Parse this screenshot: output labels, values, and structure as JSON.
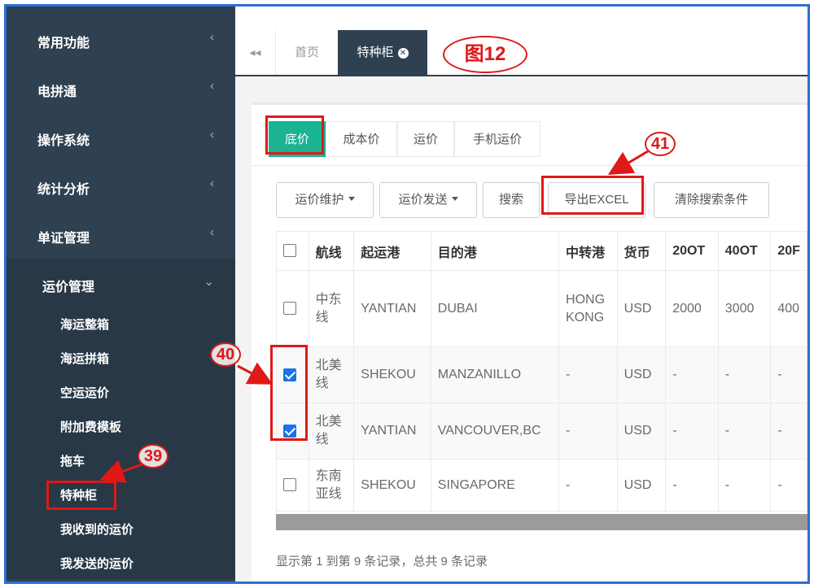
{
  "sidebar": {
    "items": [
      {
        "label": "常用功能",
        "chevron": "‹"
      },
      {
        "label": "电拼通",
        "chevron": "‹"
      },
      {
        "label": "操作系统",
        "chevron": "‹"
      },
      {
        "label": "统计分析",
        "chevron": "‹"
      },
      {
        "label": "单证管理",
        "chevron": "‹"
      },
      {
        "label": "运价管理",
        "chevron": "⌄"
      }
    ],
    "subitems": [
      "海运整箱",
      "海运拼箱",
      "空运运价",
      "附加费模板",
      "拖车",
      "特种柜",
      "我收到的运价",
      "我发送的运价"
    ]
  },
  "tabs": {
    "back_icon": "◂◂",
    "home": "首页",
    "active": "特种柜",
    "close_icon": "✕"
  },
  "figure_label": "图12",
  "subtabs": [
    "底价",
    "成本价",
    "运价",
    "手机运价"
  ],
  "toolbar": {
    "maintain": "运价维护",
    "send": "运价发送",
    "search": "搜索",
    "export": "导出EXCEL",
    "clear": "清除搜索条件"
  },
  "table": {
    "headers": [
      "航线",
      "起运港",
      "目的港",
      "中转港",
      "货币",
      "20OT",
      "40OT",
      "20F"
    ],
    "rows": [
      {
        "checked": false,
        "route": "中东线",
        "origin": "YANTIAN",
        "dest": "DUBAI",
        "transit": "HONG KONG",
        "currency": "USD",
        "c20ot": "2000",
        "c40ot": "3000",
        "c20f": "400"
      },
      {
        "checked": true,
        "route": "北美线",
        "origin": "SHEKOU",
        "dest": "MANZANILLO",
        "transit": "-",
        "currency": "USD",
        "c20ot": "-",
        "c40ot": "-",
        "c20f": "-"
      },
      {
        "checked": true,
        "route": "北美线",
        "origin": "YANTIAN",
        "dest": "VANCOUVER,BC",
        "transit": "-",
        "currency": "USD",
        "c20ot": "-",
        "c40ot": "-",
        "c20f": "-"
      },
      {
        "checked": false,
        "route": "东南亚线",
        "origin": "SHEKOU",
        "dest": "SINGAPORE",
        "transit": "-",
        "currency": "USD",
        "c20ot": "-",
        "c40ot": "-",
        "c20f": "-"
      }
    ]
  },
  "footer": "显示第 1 到第 9 条记录，总共 9 条记录",
  "annotations": {
    "a39": "39",
    "a40": "40",
    "a41": "41"
  },
  "colors": {
    "sidebar": "#2f4050",
    "accent": "#1ab394",
    "annotation": "#e01818",
    "frame": "#2d6fd1"
  }
}
